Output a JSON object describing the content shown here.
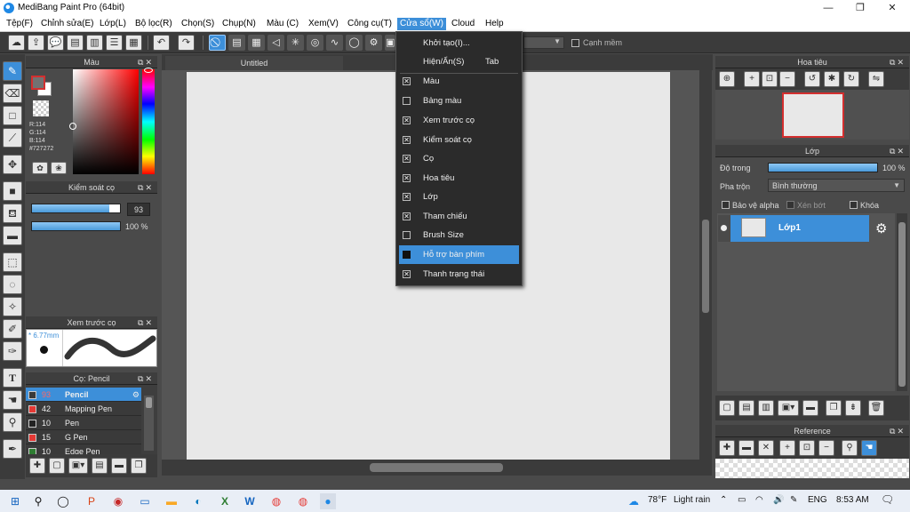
{
  "titlebar": {
    "title": "MediBang Paint Pro (64bit)",
    "minimize": "—",
    "restore": "❐",
    "close": "✕"
  },
  "menubar": {
    "items": [
      "Tệp(F)",
      "Chỉnh sửa(E)",
      "Lớp(L)",
      "Bộ lọc(R)",
      "Chọn(S)",
      "Chụp(N)",
      "Màu (C)",
      "Xem(V)",
      "Công cụ(T)",
      "Cửa sổ(W)",
      "Cloud",
      "Help"
    ]
  },
  "toolbar": {
    "antialias_label": "Cạnh mềm"
  },
  "color_panel": {
    "title": "Màu",
    "r": "R:114",
    "g": "G:114",
    "b": "B:114",
    "hex": "#727272"
  },
  "brush_control": {
    "title": "Kiểm soát cọ",
    "size_value": "93",
    "opacity_value": "100 %",
    "size_fraction": 0.93,
    "opacity_fraction": 1.0
  },
  "brush_preview": {
    "title": "Xem trước cọ",
    "size_label": "* 6.77mm"
  },
  "brush_list": {
    "title": "Cọ: Pencil",
    "items": [
      {
        "num": "93",
        "name": "Pencil",
        "color": "#3a3a3a"
      },
      {
        "num": "42",
        "name": "Mapping Pen",
        "color": "#e53935"
      },
      {
        "num": "10",
        "name": "Pen",
        "color": "#222222"
      },
      {
        "num": "15",
        "name": "G Pen",
        "color": "#e53935"
      },
      {
        "num": "10",
        "name": "Edge Pen",
        "color": "#2e7d32"
      }
    ]
  },
  "document": {
    "tab_title": "Untitled"
  },
  "navigator": {
    "title": "Hoa tiêu"
  },
  "layers": {
    "title": "Lớp",
    "opacity_label": "Độ trong",
    "opacity_value": "100 %",
    "opacity_fraction": 1.0,
    "blend_label": "Pha trộn",
    "blend_value": "Bình thường",
    "protect_alpha": "Bảo vệ alpha",
    "clipping": "Xén bớt",
    "lock": "Khóa",
    "layer_name": "Lớp1"
  },
  "reference": {
    "title": "Reference"
  },
  "window_menu": {
    "items": [
      {
        "label": "Khởi tạo(I)...",
        "shortcut": "",
        "check": "none"
      },
      {
        "label": "Hiện/Ẩn(S)",
        "shortcut": "Tab",
        "check": "none"
      },
      {
        "label": "Màu",
        "shortcut": "",
        "check": "on"
      },
      {
        "label": "Bảng màu",
        "shortcut": "",
        "check": "off"
      },
      {
        "label": "Xem trước cọ",
        "shortcut": "",
        "check": "on"
      },
      {
        "label": "Kiểm soát cọ",
        "shortcut": "",
        "check": "on"
      },
      {
        "label": "Cọ",
        "shortcut": "",
        "check": "on"
      },
      {
        "label": "Hoa tiêu",
        "shortcut": "",
        "check": "on"
      },
      {
        "label": "Lớp",
        "shortcut": "",
        "check": "on"
      },
      {
        "label": "Tham chiếu",
        "shortcut": "",
        "check": "on"
      },
      {
        "label": "Brush Size",
        "shortcut": "",
        "check": "off"
      },
      {
        "label": "Hỗ trợ bàn phím",
        "shortcut": "",
        "check": "filled"
      },
      {
        "label": "Thanh trạng thái",
        "shortcut": "",
        "check": "on"
      }
    ],
    "highlighted_index": 11
  },
  "taskbar": {
    "temperature": "78°F",
    "weather": "Light rain",
    "language": "ENG",
    "time": "8:53 AM"
  },
  "colors": {
    "accent": "#3d8fd9",
    "foreground": "#727272"
  }
}
